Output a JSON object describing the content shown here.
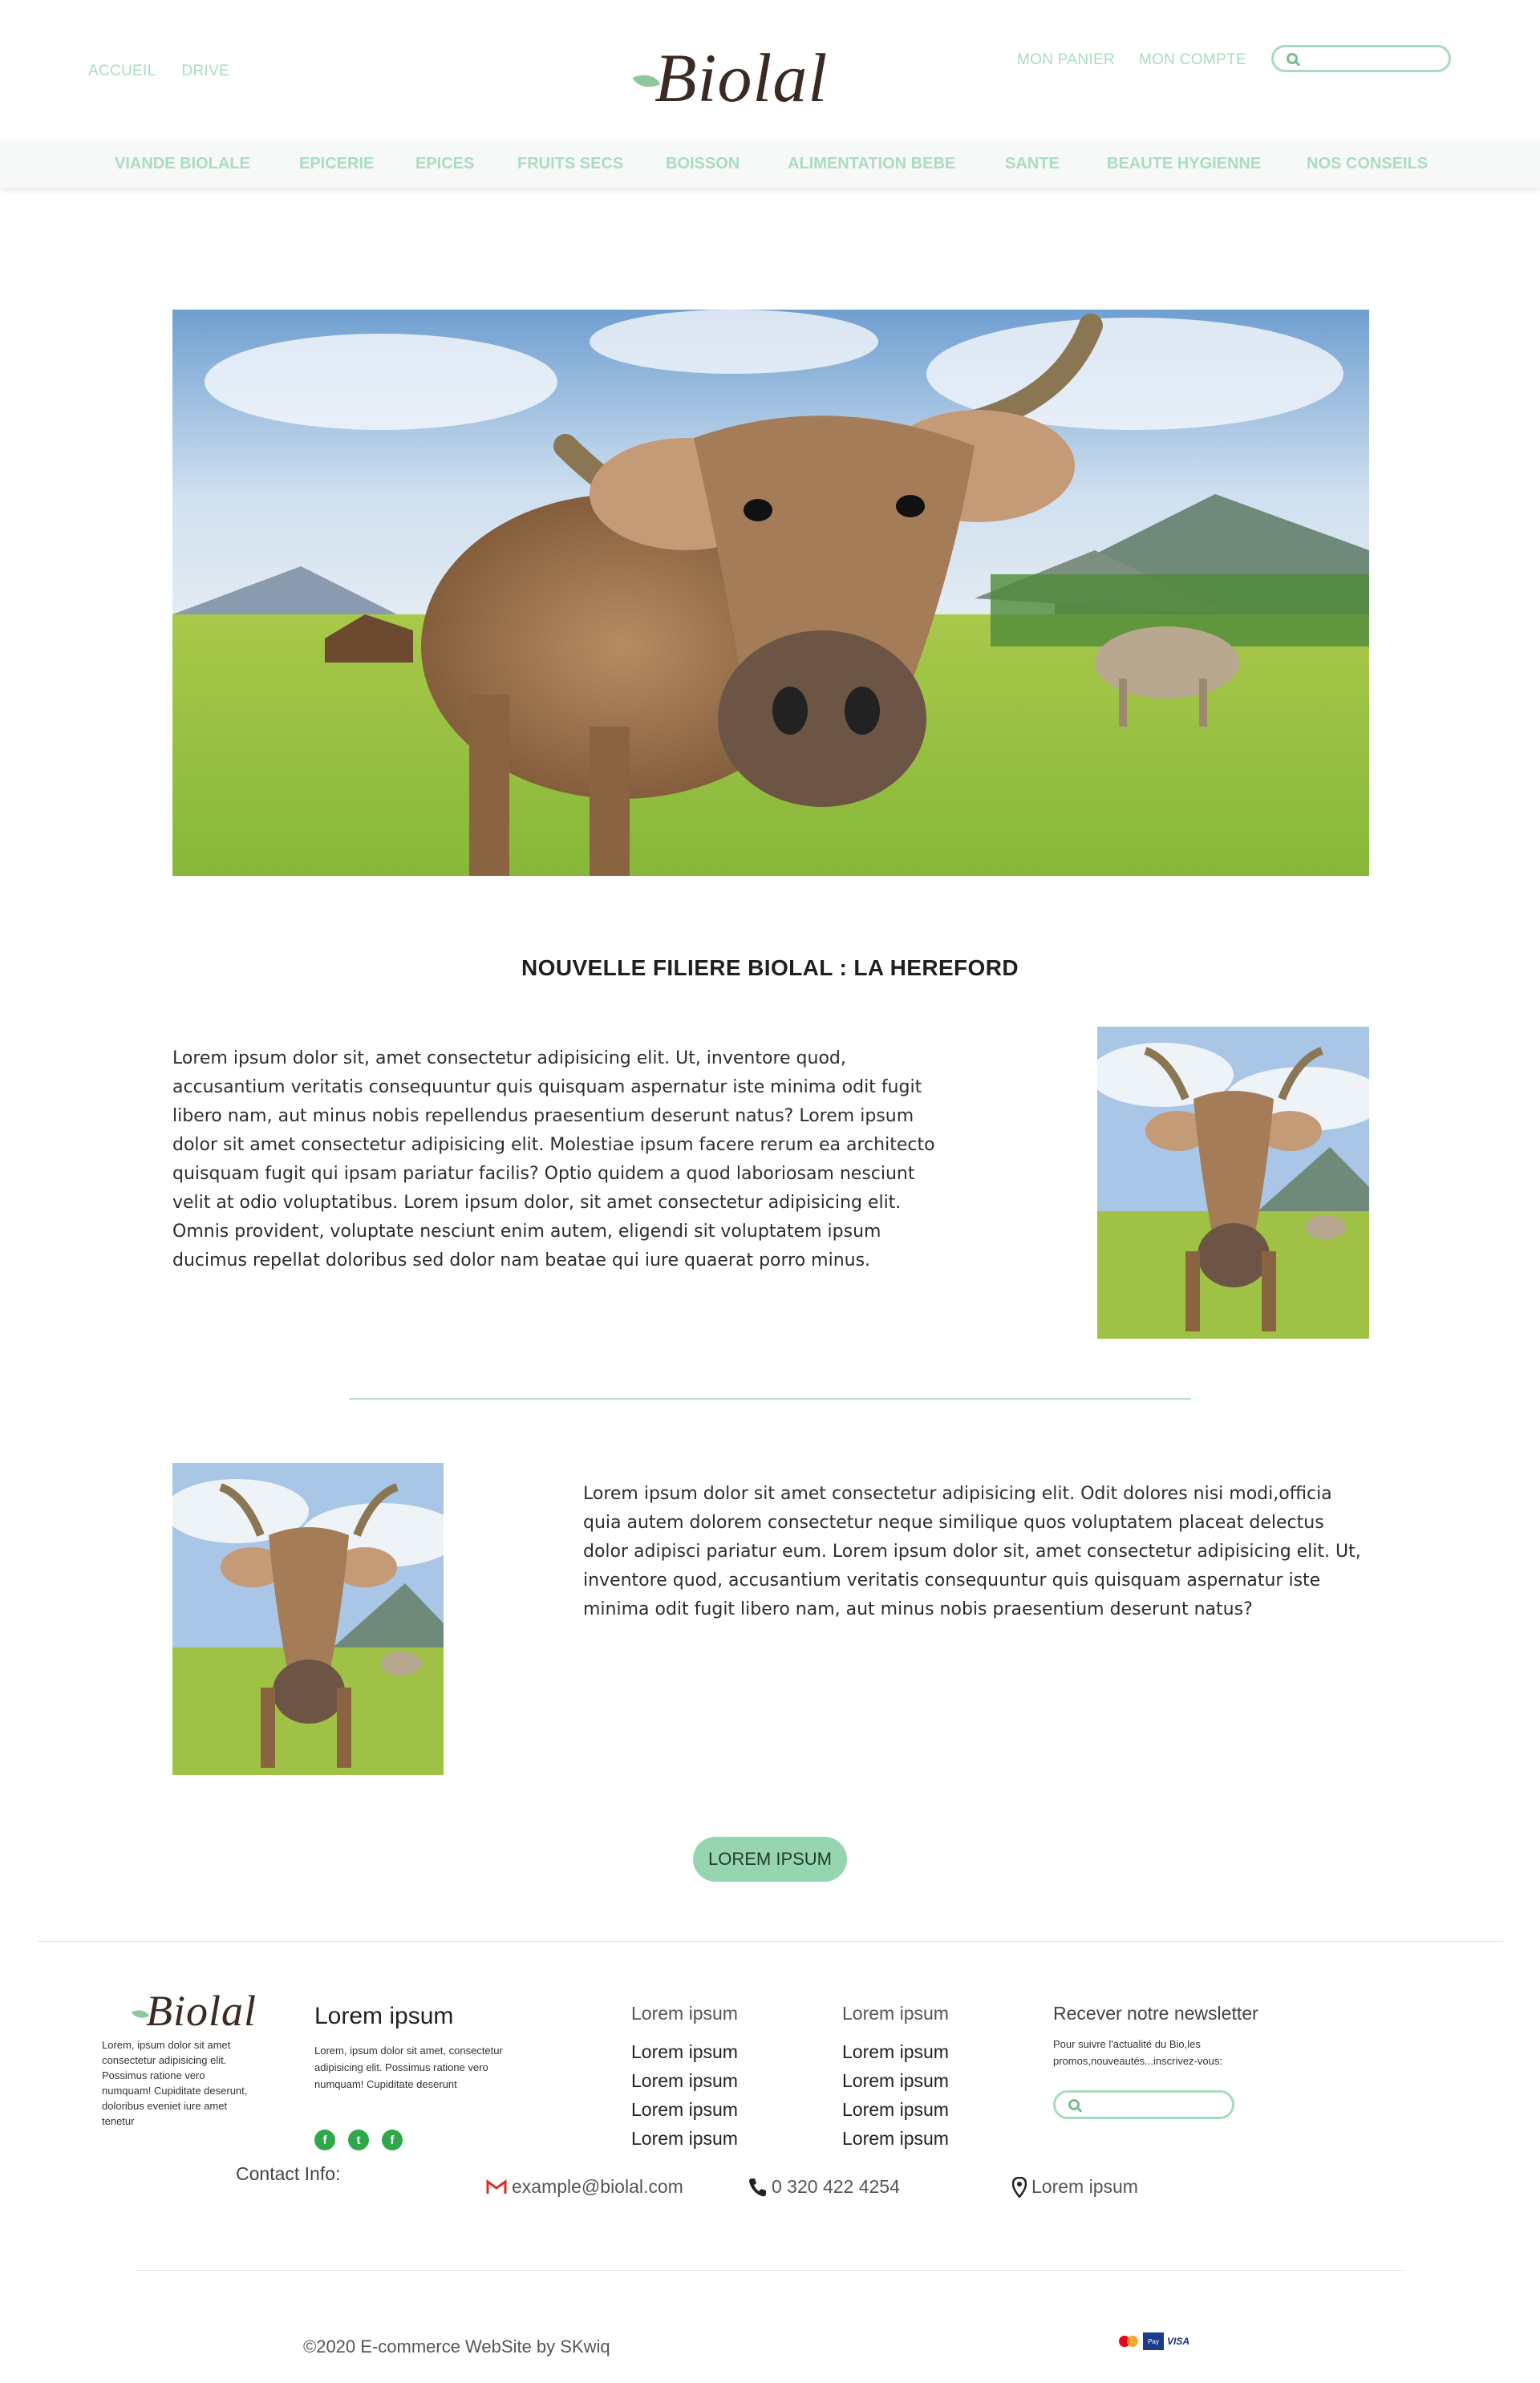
{
  "header": {
    "left_nav": [
      "ACCUEIL",
      "DRIVE"
    ],
    "logo_text": "Biolal",
    "right_nav": [
      "MON PANIER",
      "MON COMPTE"
    ],
    "search_placeholder": ""
  },
  "categories": [
    "VIANDE BIOLALE",
    "EPICERIE",
    "EPICES",
    "FRUITS SECS",
    "BOISSON",
    "ALIMENTATION BEBE",
    "SANTE",
    "BEAUTE HYGIENNE",
    "NOS CONSEILS"
  ],
  "article": {
    "title": "NOUVELLE FILIERE BIOLAL : LA HEREFORD",
    "paragraph1": "Lorem ipsum dolor sit, amet consectetur adipisicing elit. Ut, inventore quod, accusantium veritatis consequuntur quis quisquam aspernatur iste minima odit fugit libero nam, aut minus nobis repellendus praesentium deserunt natus? Lorem ipsum dolor sit amet consectetur adipisicing elit. Molestiae ipsum facere rerum ea architecto quisquam fugit qui ipsam pariatur facilis? Optio quidem a quod laboriosam nesciunt velit at odio voluptatibus. Lorem ipsum dolor, sit amet consectetur adipisicing elit. Omnis provident, voluptate nesciunt enim autem, eligendi sit voluptatem ipsum ducimus repellat doloribus sed dolor nam beatae qui iure quaerat porro minus.",
    "paragraph2": "Lorem ipsum dolor sit amet consectetur adipisicing elit. Odit dolores nisi modi,officia quia autem dolorem consectetur neque similique quos voluptatem placeat delectus dolor adipisci pariatur eum. Lorem ipsum dolor sit, amet consectetur adipisicing elit. Ut, inventore quod, accusantium veritatis consequuntur quis quisquam aspernatur iste minima odit fugit libero nam, aut minus nobis praesentium deserunt natus?",
    "cta_label": "LOREM IPSUM"
  },
  "footer": {
    "logo_text": "Biolal",
    "about": "Lorem, ipsum dolor sit amet consectetur adipisicing elit. Possimus ratione vero numquam! Cupiditate deserunt, doloribus eveniet iure amet tenetur",
    "col2_title": "Lorem ipsum",
    "col2_text": "Lorem, ipsum dolor sit amet, consectetur adipisicing elit. Possimus ratione vero numquam! Cupiditate deserunt",
    "col3_title": "Lorem ipsum",
    "col3_links": [
      "Lorem ipsum",
      "Lorem ipsum",
      "Lorem ipsum",
      "Lorem ipsum"
    ],
    "col4_title": "Lorem ipsum",
    "col4_links": [
      "Lorem ipsum",
      "Lorem ipsum",
      "Lorem ipsum",
      "Lorem ipsum"
    ],
    "newsletter_title": "Recever notre newsletter",
    "newsletter_text": "Pour suivre l'actualité du Bio,les promos,nouveautés...inscrivez-vous:",
    "newsletter_placeholder": "",
    "contact_label": "Contact Info:",
    "email": "example@biolal.com",
    "phone": "0 320 422 4254",
    "address": "Lorem ipsum",
    "copyright": "©2020 E-commerce WebSite by SKwiq",
    "payment_visa": "VISA",
    "payment_pp": "Pay"
  },
  "icons": {
    "search": "search-icon",
    "social": [
      "facebook-icon",
      "twitter-icon",
      "facebook-icon"
    ],
    "mail": "gmail-icon",
    "phone": "phone-icon",
    "location": "location-pin-icon"
  },
  "colors": {
    "accent": "#97d4b0",
    "nav_text": "#a9ddc0",
    "social": "#2fa84a"
  }
}
